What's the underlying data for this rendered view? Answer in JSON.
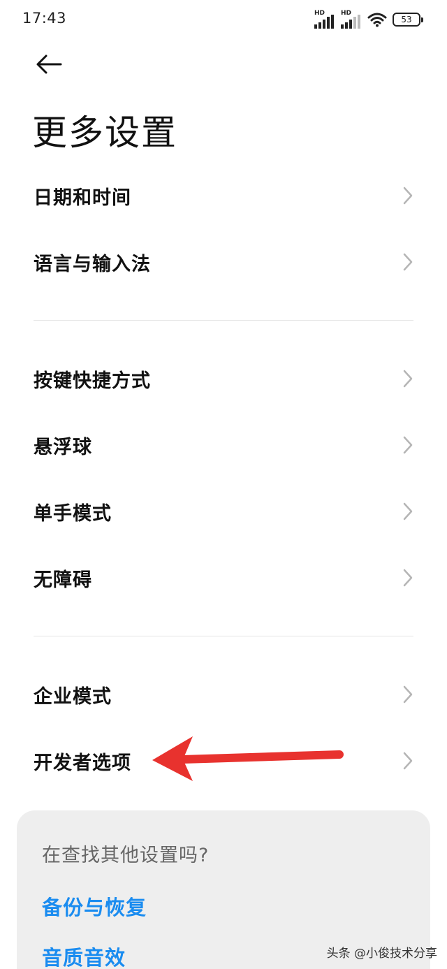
{
  "status_bar": {
    "time": "17:43",
    "signal1_label": "HD",
    "signal2_label": "HD",
    "battery": "53"
  },
  "header": {
    "back_icon": "arrow-left-icon",
    "title": "更多设置"
  },
  "groups": [
    {
      "items": [
        {
          "label": "日期和时间"
        },
        {
          "label": "语言与输入法"
        }
      ]
    },
    {
      "items": [
        {
          "label": "按键快捷方式"
        },
        {
          "label": "悬浮球"
        },
        {
          "label": "单手模式"
        },
        {
          "label": "无障碍"
        }
      ]
    },
    {
      "items": [
        {
          "label": "企业模式"
        },
        {
          "label": "开发者选项"
        }
      ]
    }
  ],
  "suggestion_card": {
    "title": "在查找其他设置吗?",
    "links": [
      {
        "label": "备份与恢复"
      },
      {
        "label": "音质音效"
      }
    ]
  },
  "annotation": {
    "color": "#e8322e",
    "points_to": "开发者选项"
  },
  "watermark": "头条 @小俊技术分享",
  "colors": {
    "accent": "#1a8cf0",
    "card_bg": "#eeeeee",
    "chevron": "#b5b5b5"
  }
}
